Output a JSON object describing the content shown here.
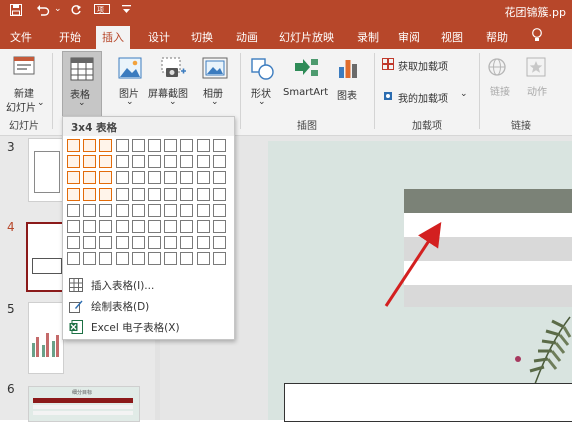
{
  "window": {
    "title": "花团锦簇.pp"
  },
  "tabs": [
    "文件",
    "开始",
    "插入",
    "设计",
    "切换",
    "动画",
    "幻灯片放映",
    "录制",
    "审阅",
    "视图",
    "帮助"
  ],
  "ribbon": {
    "new_slide": {
      "label1": "新建",
      "label2": "幻灯片"
    },
    "table": {
      "label": "表格"
    },
    "picture": {
      "label": "图片"
    },
    "screenshot": {
      "label": "屏幕截图"
    },
    "album": {
      "label": "相册"
    },
    "shapes": {
      "label": "形状"
    },
    "smartart": {
      "label": "SmartArt"
    },
    "chart": {
      "label": "图表"
    },
    "get_addins": {
      "label": "获取加载项"
    },
    "my_addins": {
      "label": "我的加载项"
    },
    "link": {
      "label": "链接"
    },
    "action": {
      "label": "动作"
    },
    "groups": {
      "slides": "幻灯片",
      "illustrations": "插图",
      "addins": "加载项",
      "links": "链接"
    }
  },
  "table_dropdown": {
    "header": "3x4 表格",
    "grid": {
      "cols": 10,
      "rows": 8,
      "selected_cols": 3,
      "selected_rows": 4
    },
    "items": [
      "插入表格(I)...",
      "绘制表格(D)",
      "Excel 电子表格(X)"
    ]
  },
  "slide_numbers": [
    "3",
    "4",
    "5",
    "6"
  ],
  "thumb6_title": "细分目标",
  "colors": {
    "accent": "#b7472a",
    "selection": "#e26b0a",
    "arrow": "#d32020"
  }
}
